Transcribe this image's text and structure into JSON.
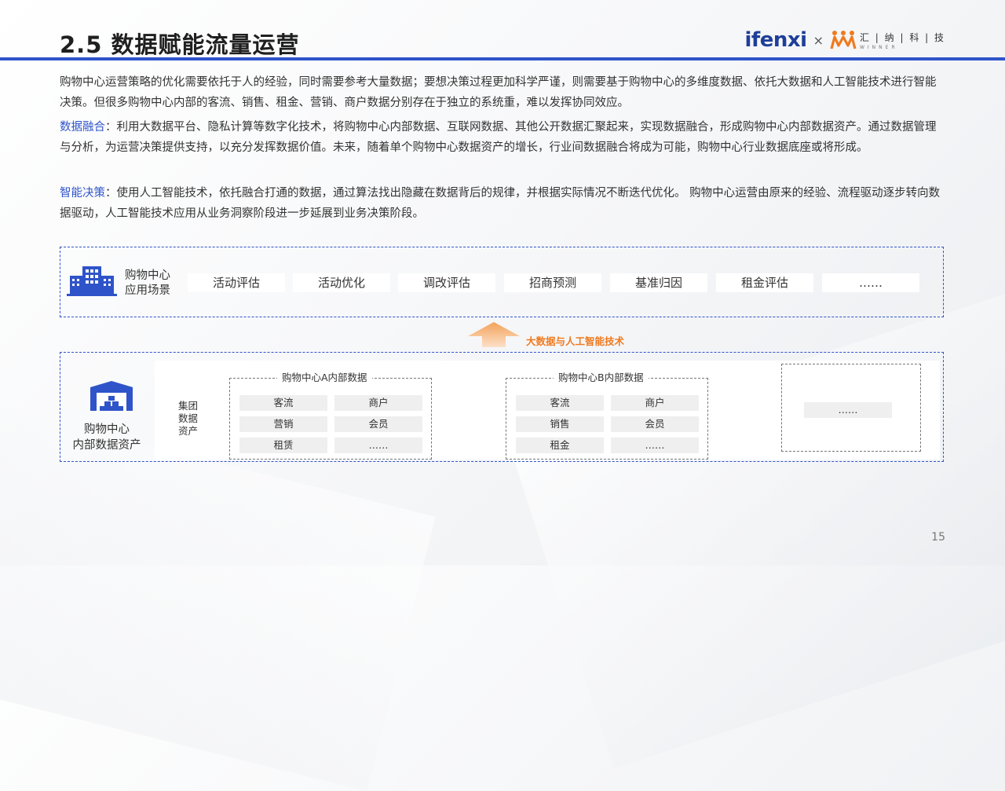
{
  "header": {
    "title": "2.5 数据赋能流量运营",
    "logo_left": "ifenxi",
    "logo_times": "×",
    "logo_right_cn": "汇 | 纳 | 科 | 技",
    "logo_right_en": "WINNER"
  },
  "paragraphs": {
    "p1": "购物中心运营策略的优化需要依托于人的经验，同时需要参考大量数据；要想决策过程更加科学严谨，则需要基于购物中心的多维度数据、依托大数据和人工智能技术进行智能决策。但很多购物中心内部的客流、销售、租金、营销、商户数据分别存在于独立的系统重，难以发挥协同效应。",
    "p2_kw": "数据融合",
    "p2": "：利用大数据平台、隐私计算等数字化技术，将购物中心内部数据、互联网数据、其他公开数据汇聚起来，实现数据融合，形成购物中心内部数据资产。通过数据管理与分析，为运营决策提供支持，以充分发挥数据价值。未来，随着单个购物中心数据资产的增长，行业间数据融合将成为可能，购物中心行业数据底座或将形成。",
    "p3_kw": "智能决策",
    "p3": "：使用人工智能技术，依托融合打通的数据，通过算法找出隐藏在数据背后的规律，并根据实际情况不断迭代优化。 购物中心运营由原来的经验、流程驱动逐步转向数据驱动，人工智能技术应用从业务洞察阶段进一步延展到业务决策阶段。"
  },
  "scenes": {
    "label_line1": "购物中心",
    "label_line2": "应用场景",
    "chips": [
      "活动评估",
      "活动优化",
      "调改评估",
      "招商预测",
      "基准归因",
      "租金评估",
      "……"
    ]
  },
  "arrow_label": "大数据与人工智能技术",
  "assets": {
    "label_line1": "购物中心",
    "label_line2": "内部数据资产",
    "group_label_lines": [
      "集团",
      "数据",
      "资产"
    ],
    "mall_a": {
      "title": "购物中心A内部数据",
      "cells": [
        "客流",
        "商户",
        "营销",
        "会员",
        "租赁",
        "……"
      ]
    },
    "mall_b": {
      "title": "购物中心B内部数据",
      "cells": [
        "客流",
        "商户",
        "销售",
        "会员",
        "租金",
        "……"
      ]
    },
    "more": "……"
  },
  "page_number": "15",
  "colors": {
    "accent_blue": "#2f54c9",
    "accent_orange": "#ef7a1e"
  }
}
